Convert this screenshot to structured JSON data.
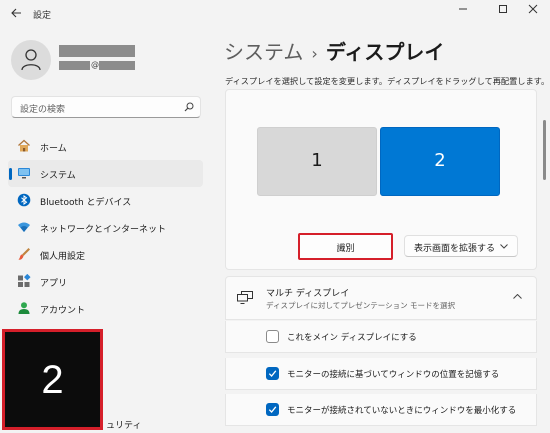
{
  "window": {
    "title": "設定"
  },
  "user": {
    "email_at": "@"
  },
  "search": {
    "placeholder": "設定の検索"
  },
  "sidebar": {
    "items": [
      {
        "label": "ホーム",
        "icon": "home-icon"
      },
      {
        "label": "システム",
        "icon": "system-icon",
        "active": true
      },
      {
        "label": "Bluetooth とデバイス",
        "icon": "bluetooth-icon"
      },
      {
        "label": "ネットワークとインターネット",
        "icon": "wifi-icon"
      },
      {
        "label": "個人用設定",
        "icon": "brush-icon"
      },
      {
        "label": "アプリ",
        "icon": "apps-icon"
      },
      {
        "label": "アカウント",
        "icon": "account-icon"
      }
    ],
    "partial_item": "ュリティ"
  },
  "identify_overlay": {
    "number": "2"
  },
  "breadcrumb": {
    "parent": "システム",
    "separator": "›",
    "current": "ディスプレイ"
  },
  "display": {
    "description": "ディスプレイを選択して設定を変更します。ディスプレイをドラッグして再配置します。",
    "monitors": [
      {
        "number": "1",
        "selected": false
      },
      {
        "number": "2",
        "selected": true
      }
    ],
    "identify_label": "識別",
    "extend_value": "表示画面を拡張する"
  },
  "multi_display": {
    "title": "マルチ ディスプレイ",
    "subtitle": "ディスプレイに対してプレゼンテーション モードを選択",
    "options": [
      {
        "label": "これをメイン ディスプレイにする",
        "checked": false
      },
      {
        "label": "モニターの接続に基づいてウィンドウの位置を記憶する",
        "checked": true
      },
      {
        "label": "モニターが接続されていないときにウィンドウを最小化する",
        "checked": true
      }
    ]
  },
  "colors": {
    "accent": "#0067c0",
    "monitor_selected": "#0078d4",
    "highlight_border": "#d51f2a"
  }
}
